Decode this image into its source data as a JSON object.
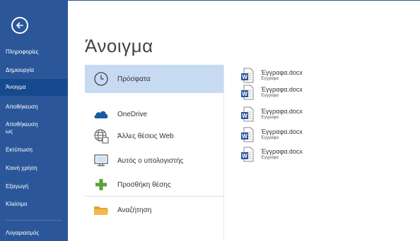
{
  "sidebar": {
    "back_icon": "back-arrow-icon",
    "items": [
      {
        "label": "Πληροφορίες"
      },
      {
        "label": "Δημιουργία"
      },
      {
        "label": "Άνοιγμα",
        "active": true
      },
      {
        "label": "Αποθήκευση"
      },
      {
        "label": "Αποθήκευση ως"
      },
      {
        "label": "Εκτύπωση"
      },
      {
        "label": "Κοινή χρήση"
      },
      {
        "label": "Εξαγωγή"
      },
      {
        "label": "Κλείσιμο"
      },
      {
        "label": "Λογαριασμός"
      }
    ]
  },
  "main": {
    "title": "Άνοιγμα",
    "locations": [
      {
        "label": "Πρόσφατα",
        "icon": "clock-icon",
        "active": true
      },
      {
        "label": "OneDrive",
        "icon": "cloud-icon"
      },
      {
        "label": "Άλλες θέσεις Web",
        "icon": "globe-icon"
      },
      {
        "label": "Αυτός ο υπολογιστής",
        "icon": "computer-icon"
      },
      {
        "label": "Προσθήκη θέσης",
        "icon": "plus-icon"
      },
      {
        "label": "Αναζήτηση",
        "icon": "folder-icon"
      }
    ],
    "recent_files": [
      {
        "name": "Έγγραφα.docx",
        "path": "Έγγραφα"
      },
      {
        "name": "Έγγραφα.docx",
        "path": "Έγγραφα"
      },
      {
        "name": "Έγγραφα.docx",
        "path": "Έγγραφα"
      },
      {
        "name": "Έγγραφα.docx",
        "path": "Έγγραφα"
      },
      {
        "name": "Έγγραφα.docx",
        "path": "Έγγραφα"
      }
    ]
  },
  "colors": {
    "sidebar_bg": "#2b579a",
    "sidebar_active": "#154a8f",
    "location_active": "#c6dbf2",
    "word_blue": "#2b579a",
    "plus_green": "#5aa13c",
    "folder_yellow": "#f2b84b",
    "cloud_blue": "#1b5aa3"
  }
}
